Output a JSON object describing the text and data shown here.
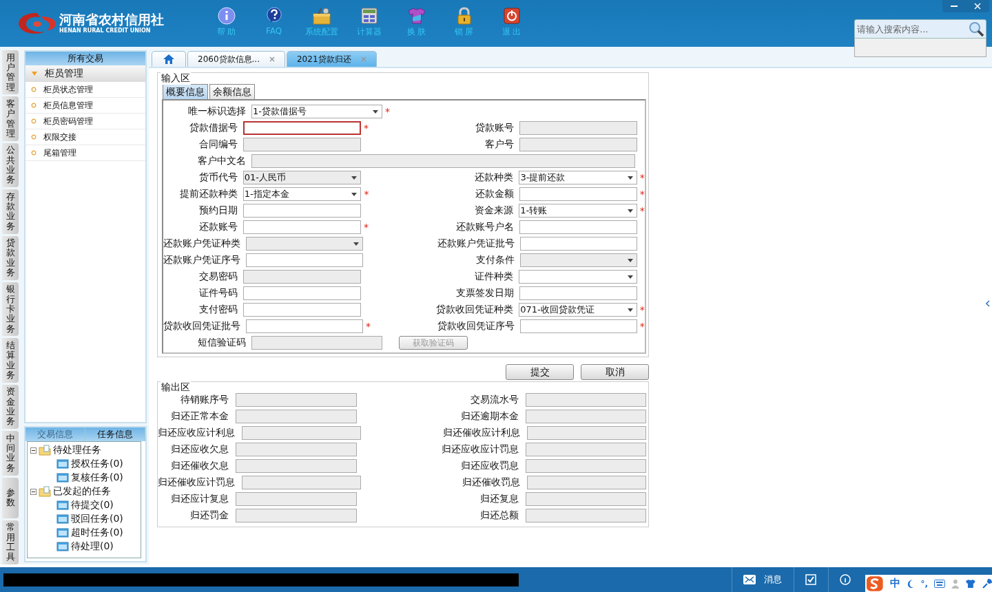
{
  "header": {
    "logo_cn": "河南省农村信用社",
    "logo_en": "HENAN RURAL CREDIT UNION",
    "toolbar": [
      {
        "kind": "info",
        "label": "帮 助"
      },
      {
        "kind": "faq",
        "label": "FAQ"
      },
      {
        "kind": "config",
        "label": "系统配置"
      },
      {
        "kind": "calc",
        "label": "计算器"
      },
      {
        "kind": "skin",
        "label": "换 肤"
      },
      {
        "kind": "lock",
        "label": "锁 屏"
      },
      {
        "kind": "exit",
        "label": "退 出"
      }
    ],
    "search": {
      "placeholder": "请输入搜索内容..."
    }
  },
  "side_tabs": [
    "用户管理",
    "客户管理",
    "公共业务",
    "存款业务",
    "贷款业务",
    "银行卡业务",
    "结算业务",
    "资金业务",
    "中间业务",
    "参数",
    "常用工具"
  ],
  "sidebar": {
    "title": "所有交易",
    "group": {
      "label": "柜员管理",
      "expanded": true,
      "items": [
        "柜员状态管理",
        "柜员信息管理",
        "柜员密码管理",
        "权限交接",
        "尾箱管理"
      ]
    }
  },
  "task_panel": {
    "tabs": [
      {
        "label": "交易信息",
        "selected": false
      },
      {
        "label": "任务信息",
        "selected": true
      }
    ],
    "tree": [
      {
        "label": "待处理任务",
        "expanded": true,
        "children": [
          {
            "label": "授权任务(0)"
          },
          {
            "label": "复核任务(0)"
          }
        ]
      },
      {
        "label": "已发起的任务",
        "expanded": true,
        "children": [
          {
            "label": "待提交(0)"
          },
          {
            "label": "驳回任务(0)"
          },
          {
            "label": "超时任务(0)"
          },
          {
            "label": "待处理(0)"
          }
        ]
      }
    ]
  },
  "tabs": [
    {
      "kind": "home",
      "selected": false
    },
    {
      "kind": "page",
      "label": "2060贷款信息...",
      "selected": false
    },
    {
      "kind": "page",
      "label": "2021贷款归还",
      "selected": true
    }
  ],
  "input_area": {
    "title": "输入区",
    "tabs": [
      {
        "label": "概要信息",
        "selected": true
      },
      {
        "label": "余额信息",
        "selected": false
      }
    ],
    "rows": [
      [
        {
          "label": "唯一标识选择",
          "kind": "select",
          "value": "1-贷款借据号",
          "required": true
        }
      ],
      [
        {
          "label": "贷款借据号",
          "kind": "text",
          "required": true,
          "invalid": true
        },
        {
          "label": "贷款账号",
          "kind": "readonly"
        }
      ],
      [
        {
          "label": "合同编号",
          "kind": "readonly"
        },
        {
          "label": "客户号",
          "kind": "readonly"
        }
      ],
      [
        {
          "label": "客户中文名",
          "kind": "readonly-wide"
        }
      ],
      [
        {
          "label": "货币代号",
          "kind": "select-disabled",
          "value": "01-人民币"
        },
        {
          "label": "还款种类",
          "kind": "select",
          "value": "3-提前还款",
          "required": true
        }
      ],
      [
        {
          "label": "提前还款种类",
          "kind": "select",
          "value": "1-指定本金",
          "required": true
        },
        {
          "label": "还款金额",
          "kind": "text",
          "required": true
        }
      ],
      [
        {
          "label": "预约日期",
          "kind": "text"
        },
        {
          "label": "资金来源",
          "kind": "select",
          "value": "1-转账",
          "required": true
        }
      ],
      [
        {
          "label": "还款账号",
          "kind": "text",
          "required": true
        },
        {
          "label": "还款账号户名",
          "kind": "text"
        }
      ],
      [
        {
          "label": "还款账户凭证种类",
          "kind": "select-disabled"
        },
        {
          "label": "还款账户凭证批号",
          "kind": "text"
        }
      ],
      [
        {
          "label": "还款账户凭证序号",
          "kind": "text"
        },
        {
          "label": "支付条件",
          "kind": "select-disabled"
        }
      ],
      [
        {
          "label": "交易密码",
          "kind": "readonly"
        },
        {
          "label": "证件种类",
          "kind": "select"
        }
      ],
      [
        {
          "label": "证件号码",
          "kind": "text"
        },
        {
          "label": "支票签发日期",
          "kind": "text"
        }
      ],
      [
        {
          "label": "支付密码",
          "kind": "text"
        },
        {
          "label": "贷款收回凭证种类",
          "kind": "select",
          "value": "071-收回贷款凭证",
          "required": true
        }
      ],
      [
        {
          "label": "贷款收回凭证批号",
          "kind": "text",
          "required": true
        },
        {
          "label": "贷款收回凭证序号",
          "kind": "text",
          "required": true
        }
      ],
      [
        {
          "label": "短信验证码",
          "kind": "readonly"
        },
        {
          "label": "获取验证码",
          "kind": "button",
          "disabled": true
        }
      ]
    ],
    "required_mark": "*"
  },
  "buttons": [
    "提交",
    "取消"
  ],
  "output_area": {
    "title": "输出区",
    "fields": [
      "待销账序号",
      "交易流水号",
      "归还正常本金",
      "归还逾期本金",
      "归还应收应计利息",
      "归还催收应计利息",
      "归还应收欠息",
      "归还应收应计罚息",
      "归还催收欠息",
      "归还应收罚息",
      "归还催收应计罚息",
      "归还催收罚息",
      "归还应计复息",
      "归还复息",
      "归还罚金",
      "归还总额"
    ]
  },
  "status_bar": {
    "items": [
      {
        "kind": "mail",
        "label": "消息"
      },
      {
        "kind": "check"
      },
      {
        "kind": "info"
      }
    ]
  },
  "ime_bar": {
    "texts": [
      "中",
      "°,"
    ]
  }
}
